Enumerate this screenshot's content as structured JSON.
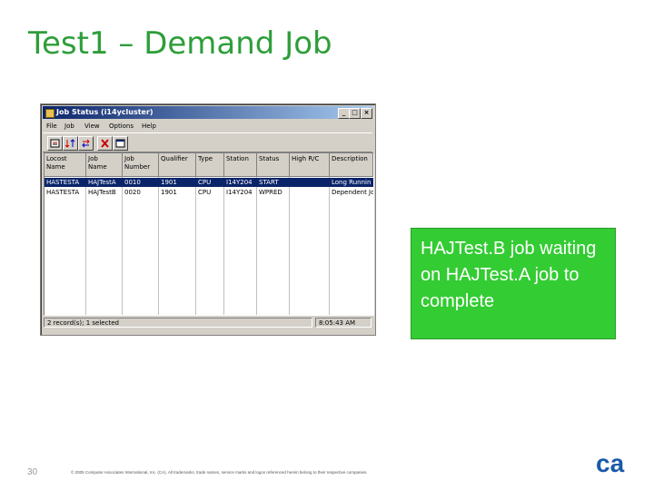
{
  "slide": {
    "title": "Test1 – Demand Job",
    "page_number": "30",
    "copyright": "© 2005 Computer Associates International, Inc. (CA). All trademarks, trade names, service marks and logos referenced herein belong to their respective companies.",
    "logo_text": "ca",
    "accent_color": "#2e9e3a",
    "callout_color": "#33cc33"
  },
  "window": {
    "title": "Job Status (i14ycluster)",
    "controls": {
      "minimize": "_",
      "maximize": "□",
      "close": "×"
    },
    "menu": [
      "File",
      "Job",
      "View",
      "Options",
      "Help"
    ],
    "toolbar_icons": [
      "properties-icon",
      "sort-icon",
      "refresh-icon",
      "cancel-job-icon",
      "window-icon"
    ],
    "columns": [
      [
        "Locost",
        "Name"
      ],
      [
        "Job",
        "Name"
      ],
      [
        "Job",
        "Number"
      ],
      [
        "Qualifier"
      ],
      [
        "Type"
      ],
      [
        "Station"
      ],
      [
        "Status"
      ],
      [
        "High R/C"
      ],
      [
        "Description"
      ]
    ],
    "rows": [
      {
        "selected": true,
        "cells": [
          "HASTESTA",
          "HAJTestA",
          "0010",
          "1901",
          "CPU",
          "I14Y204",
          "START",
          "",
          "Long Runnin"
        ]
      },
      {
        "selected": false,
        "cells": [
          "HASTESTA",
          "HAJTestB",
          "0020",
          "1901",
          "CPU",
          "I14Y204",
          "WPRED",
          "",
          "Dependent Jo"
        ]
      }
    ],
    "status": {
      "records": "2 record(s); 1 selected",
      "time": "8:05:43 AM"
    }
  },
  "callout": {
    "text": "HAJTest.B job waiting on HAJTest.A job to complete"
  }
}
